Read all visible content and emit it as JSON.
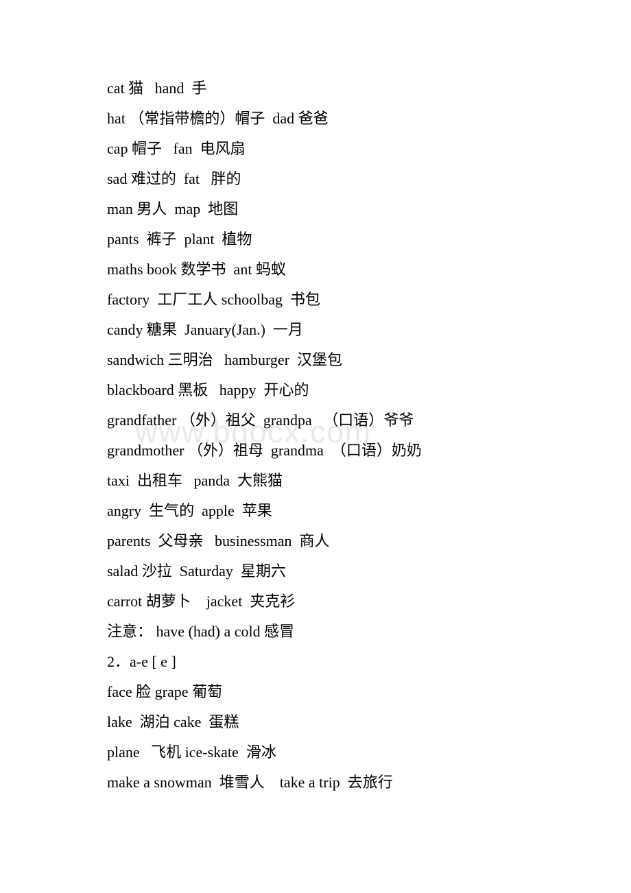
{
  "document": {
    "watermark": "www.bdocx.com",
    "watermark_color": "#e9e9e9",
    "text_color": "#000000",
    "background_color": "#ffffff",
    "lines": [
      {
        "id": "line-cat",
        "text": "cat 猫   hand  手"
      },
      {
        "id": "line-hat",
        "text": "hat （常指带檐的）帽子  dad 爸爸"
      },
      {
        "id": "line-cap",
        "text": "cap 帽子   fan  电风扇"
      },
      {
        "id": "line-sad",
        "text": "sad 难过的  fat   胖的"
      },
      {
        "id": "line-man",
        "text": "man 男人  map  地图"
      },
      {
        "id": "line-pants",
        "text": "pants  裤子  plant  植物"
      },
      {
        "id": "line-maths-book",
        "text": "maths book 数学书  ant 蚂蚁"
      },
      {
        "id": "line-factory",
        "text": "factory  工厂工人 schoolbag  书包"
      },
      {
        "id": "line-candy",
        "text": "candy 糖果  January(Jan.)  一月"
      },
      {
        "id": "line-sandwich",
        "text": "sandwich 三明治   hamburger  汉堡包"
      },
      {
        "id": "line-blackboard",
        "text": "blackboard 黑板   happy  开心的"
      },
      {
        "id": "line-grandfather",
        "text": "grandfather （外）祖父  grandpa   （口语）爷爷"
      },
      {
        "id": "line-grandmother",
        "text": "grandmother （外）祖母  grandma  （口语）奶奶"
      },
      {
        "id": "line-taxi",
        "text": "taxi  出租车   panda  大熊猫"
      },
      {
        "id": "line-angry",
        "text": "angry  生气的  apple  苹果"
      },
      {
        "id": "line-parents",
        "text": "parents  父母亲   businessman  商人"
      },
      {
        "id": "line-salad",
        "text": "salad 沙拉  Saturday  星期六"
      },
      {
        "id": "line-carrot",
        "text": "carrot 胡萝卜    jacket  夹克衫"
      },
      {
        "id": "line-note-cold",
        "text": "注意： have (had) a cold 感冒"
      },
      {
        "id": "line-section-2",
        "text": "2．a-e [ e ]"
      },
      {
        "id": "line-face",
        "text": "face 脸 grape 葡萄"
      },
      {
        "id": "line-lake",
        "text": "lake  湖泊 cake  蛋糕"
      },
      {
        "id": "line-plane",
        "text": "plane   飞机 ice-skate  滑冰"
      },
      {
        "id": "line-make-snowman",
        "text": "make a snowman  堆雪人    take a trip  去旅行"
      }
    ]
  }
}
